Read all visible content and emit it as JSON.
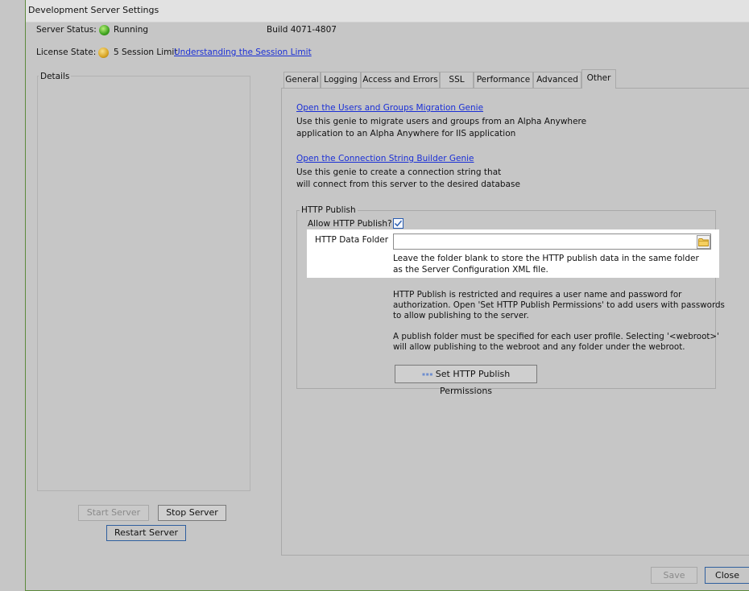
{
  "window": {
    "title": "Development Server Settings"
  },
  "status": {
    "server_label": "Server Status:",
    "server_value": "Running",
    "build": "Build 4071-4807",
    "license_label": "License State:",
    "license_value": "5 Session Limit",
    "license_link": "Understanding the Session Limit"
  },
  "details": {
    "legend": "Details"
  },
  "buttons": {
    "start": "Start Server",
    "stop": "Stop Server",
    "restart": "Restart Server",
    "save": "Save",
    "close": "Close"
  },
  "tabs": [
    {
      "label": "General"
    },
    {
      "label": "Logging"
    },
    {
      "label": "Access and Errors"
    },
    {
      "label": "SSL"
    },
    {
      "label": "Performance"
    },
    {
      "label": "Advanced"
    },
    {
      "label": "Other",
      "active": true
    }
  ],
  "other": {
    "migration_link": "Open the Users and Groups Migration Genie",
    "migration_desc_1": "Use this genie to migrate users and groups from an Alpha Anywhere",
    "migration_desc_2": "application to an Alpha Anywhere for IIS application",
    "conn_link": "Open the Connection String Builder Genie",
    "conn_desc_1": "Use this genie to create a connection string that",
    "conn_desc_2": "will connect from this server to the desired database",
    "http_legend": "HTTP Publish",
    "allow_label": "Allow HTTP Publish?",
    "allow_checked": true,
    "folder_label": "HTTP Data Folder",
    "folder_value": "",
    "folder_hint_1": "Leave the folder blank to store the HTTP publish data in the same folder",
    "folder_hint_2": "as the Server Configuration XML file.",
    "restrict_1": "HTTP Publish is restricted and requires a user name and password for",
    "restrict_2": "authorization. Open 'Set HTTP Publish Permissions' to add users with passwords",
    "restrict_3": "to allow publishing to the server.",
    "profile_1": "A publish folder must be specified for each user profile.  Selecting '<webroot>'",
    "profile_2": "will allow publishing to the webroot and any folder under the webroot.",
    "permissions_button": "Set HTTP Publish Permissions"
  },
  "icons": {
    "server_status": "green-status-dot-icon",
    "license_state": "yellow-status-dot-icon",
    "folder": "folder-icon",
    "permissions": "users-icon",
    "checkbox": "checkmark-icon"
  },
  "colors": {
    "background": "#c6c6c6",
    "link": "#1a2fd6",
    "running": "#3ea21e",
    "license": "#d8a423",
    "highlight": "#ffffff"
  }
}
